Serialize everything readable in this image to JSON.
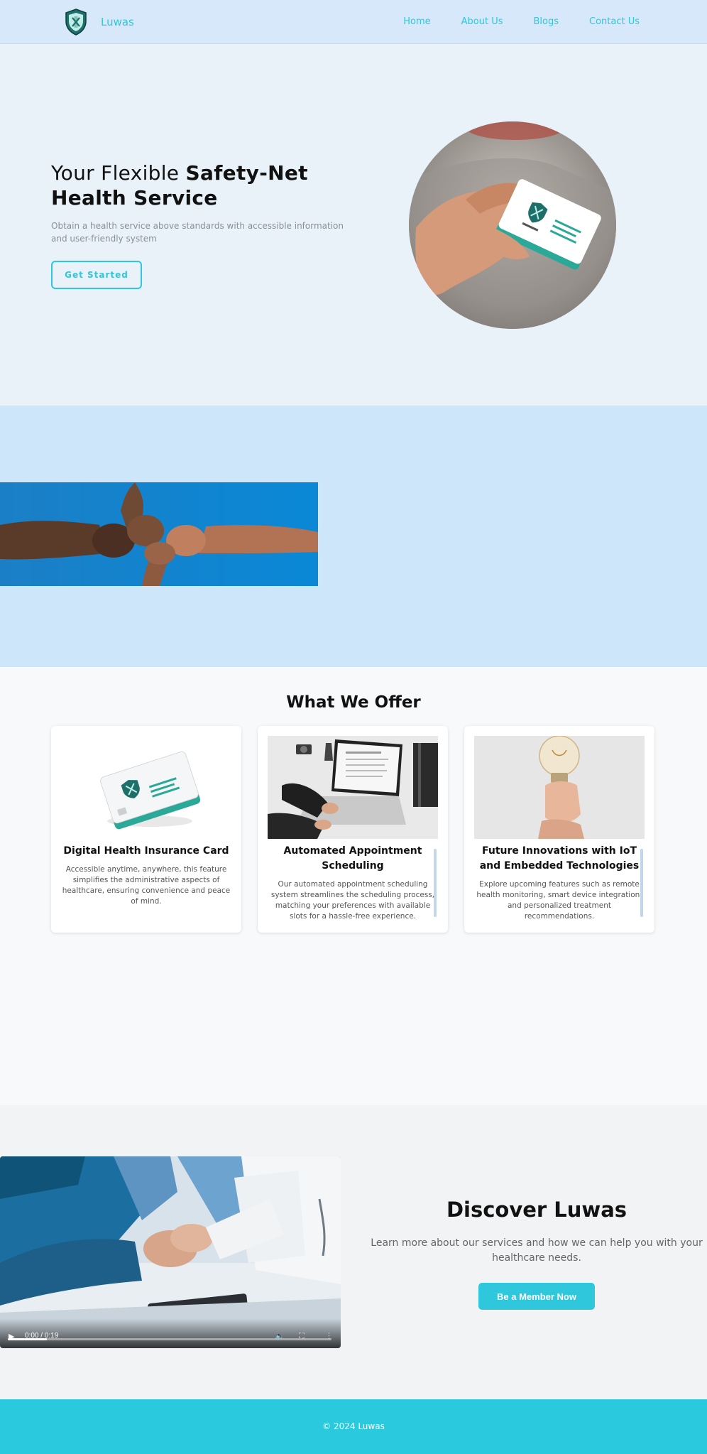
{
  "nav": {
    "brand": "Luwas",
    "links": [
      "Home",
      "About Us",
      "Blogs",
      "Contact Us"
    ]
  },
  "hero": {
    "title_part1": "Your Flexible ",
    "title_bold": "Safety-Net Health Service",
    "subtitle": "Obtain a health service above standards with accessible information and user-friendly system",
    "cta": "Get Started"
  },
  "offer": {
    "title": "What We Offer",
    "cards": [
      {
        "title": "Digital Health Insurance Card",
        "desc": "Accessible anytime, anywhere, this feature simplifies the administrative aspects of healthcare, ensuring convenience and peace of mind."
      },
      {
        "title": "Automated Appointment Scheduling",
        "desc": "Our automated appointment scheduling system streamlines the scheduling process, matching your preferences with available slots for a hassle-free experience."
      },
      {
        "title": "Future Innovations with IoT and Embedded Technologies",
        "desc": "Explore upcoming features such as remote health monitoring, smart device integration, and personalized treatment recommendations."
      }
    ]
  },
  "discover": {
    "title": "Discover Luwas",
    "subtitle": "Learn more about our services and how we can help you with your healthcare needs.",
    "cta": "Be a Member Now",
    "video": {
      "time": "0:00 / 0:19",
      "progress": 0.12
    }
  },
  "footer": {
    "text": "© 2024 Luwas"
  },
  "colors": {
    "accent": "#2ec7dc",
    "nav_bg": "#d7e8fb",
    "hero_bg": "#eaf2f9",
    "band_bg": "#cde6f9",
    "footer_bg": "#2ac9dd"
  }
}
